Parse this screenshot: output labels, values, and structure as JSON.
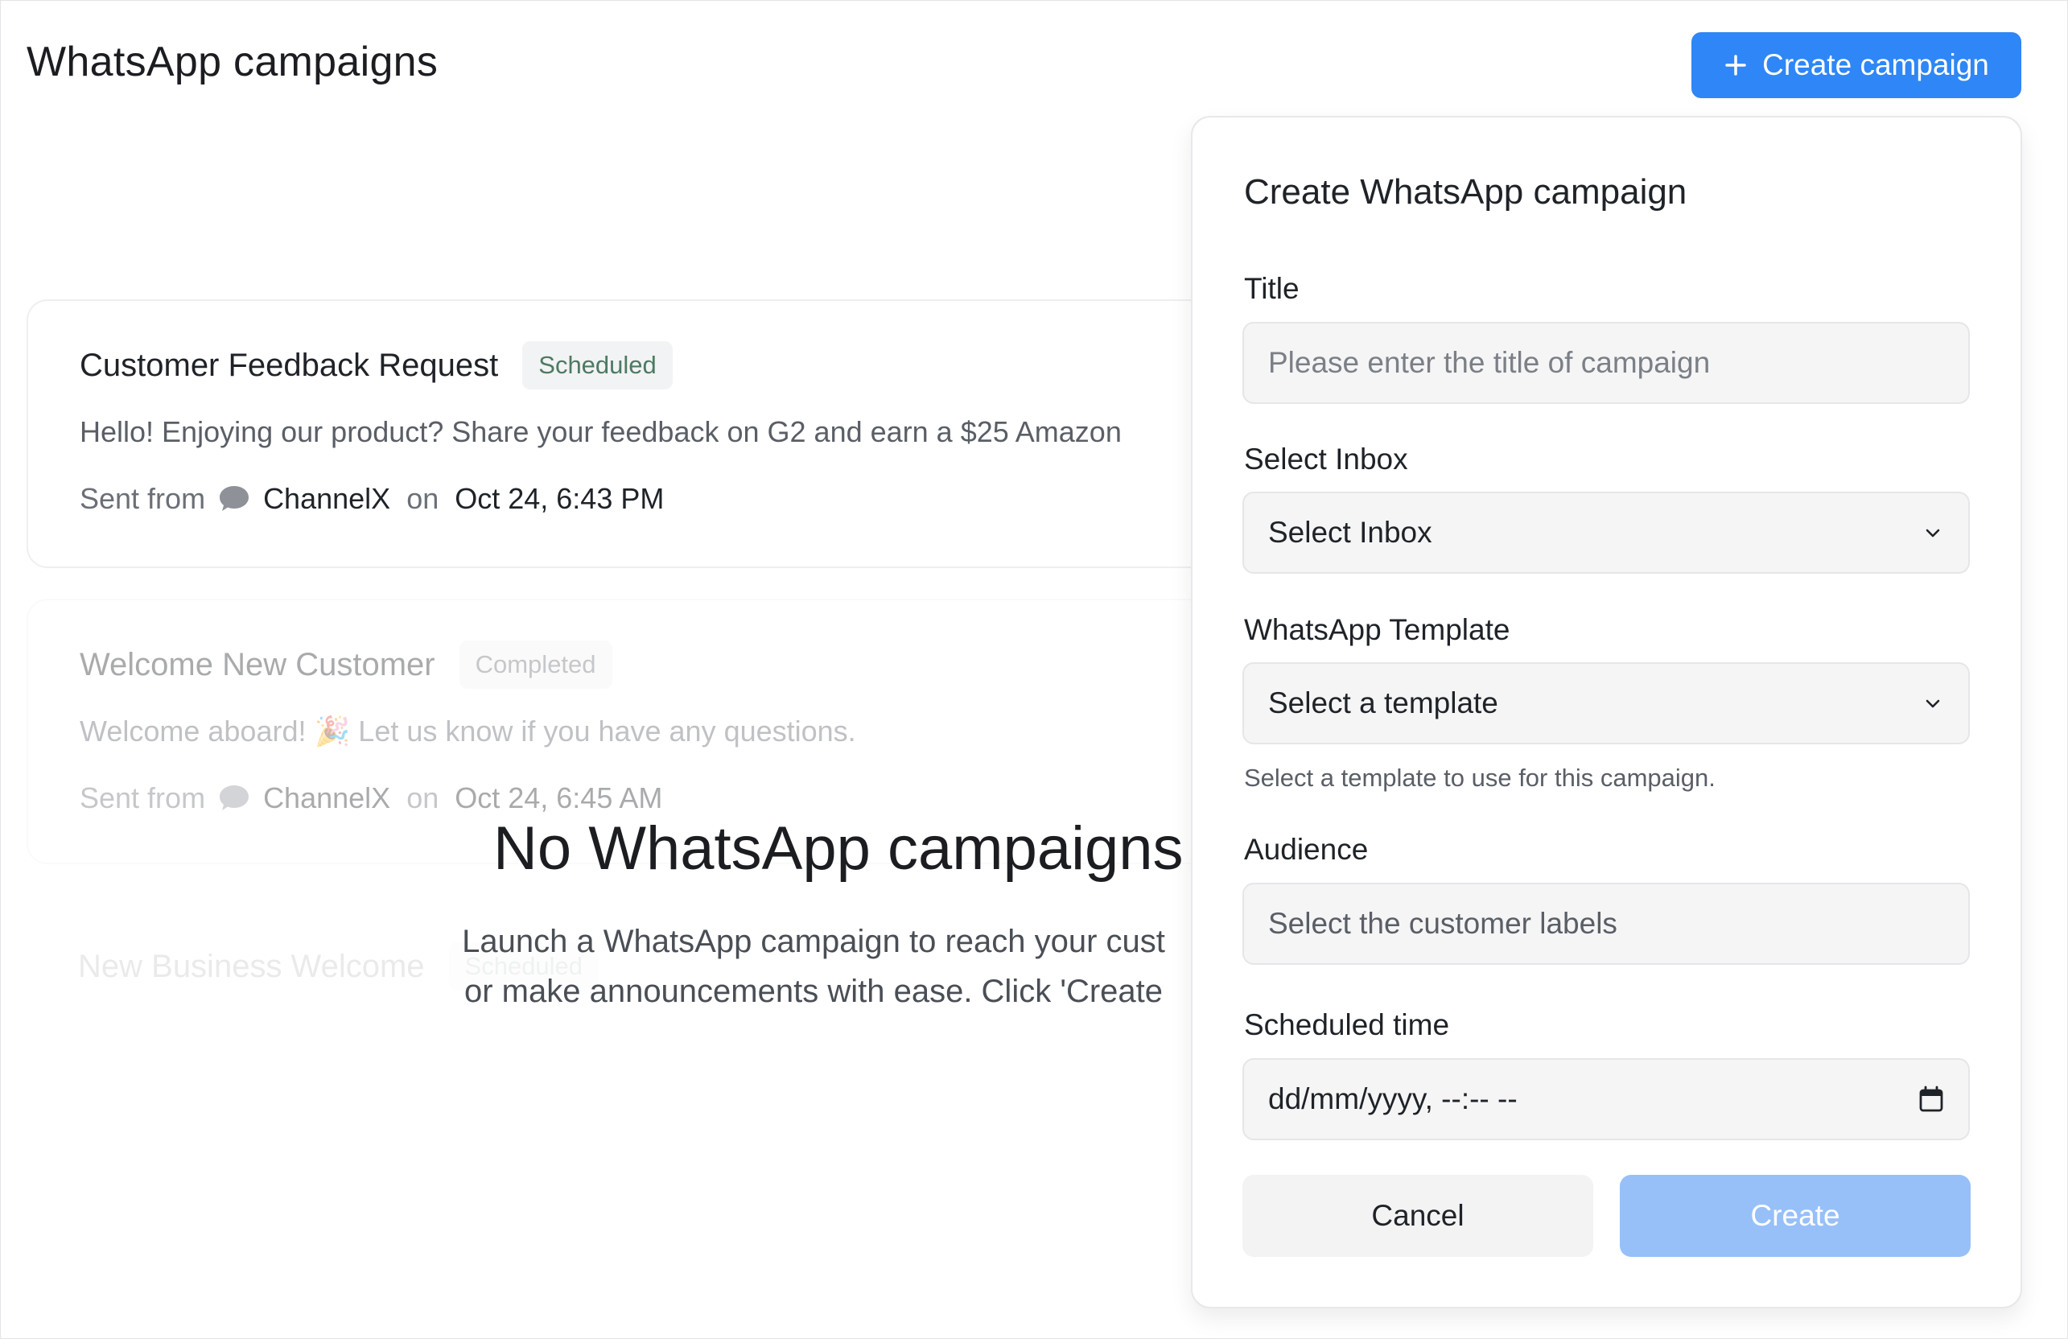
{
  "header": {
    "title": "WhatsApp campaigns",
    "create_button_label": "Create campaign"
  },
  "campaigns": [
    {
      "title": "Customer Feedback Request",
      "status": "Scheduled",
      "message": "Hello! Enjoying our product? Share your feedback on G2 and earn a $25 Amazon",
      "sent_from_label": "Sent from",
      "inbox": "ChannelX",
      "on_label": "on",
      "date": "Oct 24, 6:43 PM"
    },
    {
      "title": "Welcome New Customer",
      "status": "Completed",
      "message": "Welcome aboard! 🎉 Let us know if you have any questions.",
      "sent_from_label": "Sent from",
      "inbox": "ChannelX",
      "on_label": "on",
      "date": "Oct 24, 6:45 AM"
    },
    {
      "title": "New Business Welcome",
      "status": "Scheduled"
    }
  ],
  "empty_state": {
    "title": "No WhatsApp campaigns",
    "description_line1": "Launch a WhatsApp campaign to reach your cust",
    "description_line2": "or make announcements with ease. Click 'Create"
  },
  "modal": {
    "title": "Create WhatsApp campaign",
    "title_label": "Title",
    "title_placeholder": "Please enter the title of campaign",
    "inbox_label": "Select Inbox",
    "inbox_value": "Select Inbox",
    "template_label": "WhatsApp Template",
    "template_value": "Select a template",
    "template_helper": "Select a template to use for this campaign.",
    "audience_label": "Audience",
    "audience_placeholder": "Select the customer labels",
    "scheduled_label": "Scheduled time",
    "scheduled_placeholder": "dd/mm/yyyy, --:-- --",
    "cancel_label": "Cancel",
    "create_label": "Create"
  },
  "colors": {
    "primary": "#2f86f6",
    "primary_disabled": "#97c0f9",
    "badge_scheduled_text": "#4d7a62"
  },
  "icons": {
    "create": "plus-icon",
    "inbox": "chat-bubble-icon",
    "dropdown": "chevron-down-icon",
    "calendar": "calendar-icon"
  }
}
